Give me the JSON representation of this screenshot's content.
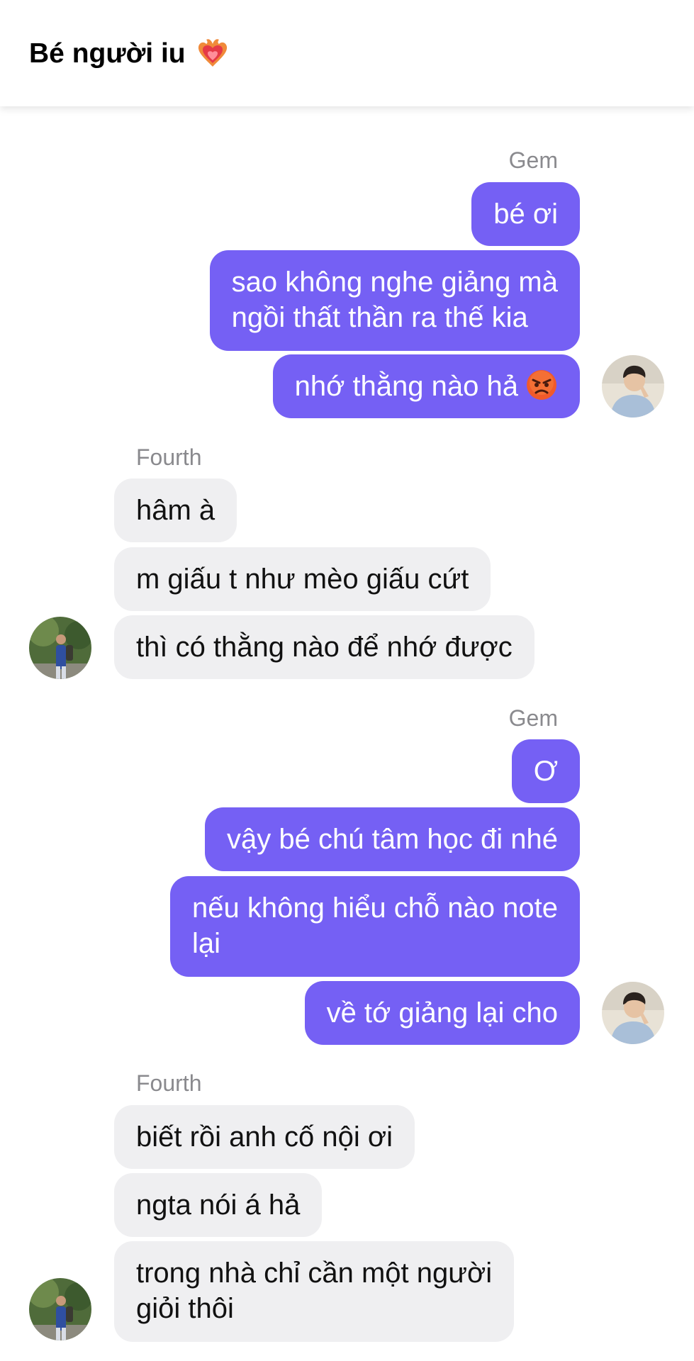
{
  "header": {
    "title": "Bé người iu",
    "title_icon": "burning-heart-icon"
  },
  "colors": {
    "outgoing_bubble": "#7560f4",
    "incoming_bubble": "#efeff1",
    "sender_label": "#8a8a8e"
  },
  "messages": {
    "group1": {
      "sender": "Gem",
      "m1": "bé ơi",
      "m2a": "sao không nghe giảng mà",
      "m2b": "ngồi thất thần ra thế kia",
      "m3": "nhớ thằng nào hả",
      "m3_icon": "angry-face-icon"
    },
    "group2": {
      "sender": "Fourth",
      "m1": "hâm à",
      "m2": "m giấu t như mèo giấu cứt",
      "m3": "thì có thằng nào để nhớ được"
    },
    "group3": {
      "sender": "Gem",
      "m1": "Ơ",
      "m2": "vậy bé chú tâm học đi nhé",
      "m3a": "nếu không hiểu chỗ nào note",
      "m3b": "lại",
      "m4": "về tớ giảng lại cho"
    },
    "group4": {
      "sender": "Fourth",
      "m1": "biết rồi anh cố nội ơi",
      "m2": "ngta nói á hả",
      "m3a": "trong nhà chỉ cần một người",
      "m3b": "giỏi thôi"
    }
  }
}
